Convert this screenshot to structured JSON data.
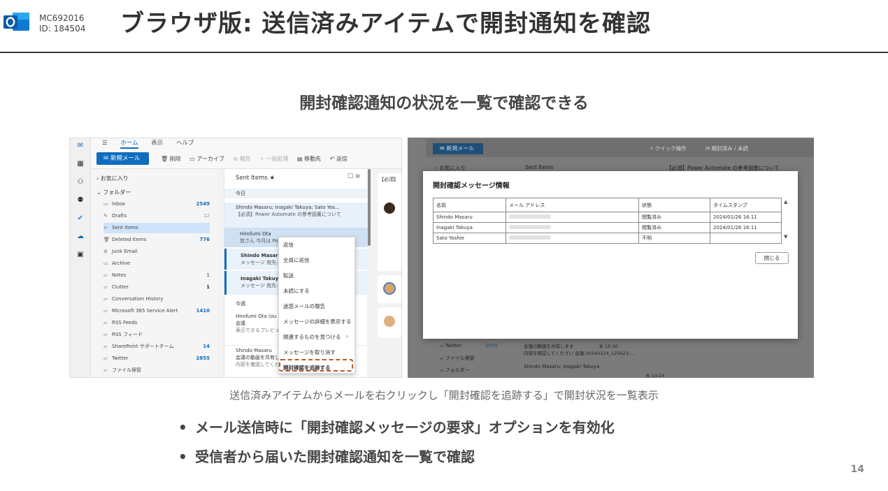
{
  "header": {
    "id_code": "MC692016",
    "id_label": "ID: 184504",
    "title": "ブラウザ版: 送信済みアイテムで開封通知を確認"
  },
  "subtitle": "開封確認通知の状況を一覧で確認できる",
  "left_screenshot": {
    "tabs": [
      "ホーム",
      "表示",
      "ヘルプ"
    ],
    "new_mail": "新規メール",
    "toolbar": [
      "削除",
      "アーカイブ",
      "報告",
      "一括処理",
      "移動先",
      "返信"
    ],
    "favorites": "お気に入り",
    "folders_head": "フォルダー",
    "folders": [
      {
        "name": "Inbox",
        "count": "2549"
      },
      {
        "name": "Drafts",
        "count": "12"
      },
      {
        "name": "Sent Items",
        "count": ""
      },
      {
        "name": "Deleted Items",
        "count": "776"
      },
      {
        "name": "Junk Email",
        "count": ""
      },
      {
        "name": "Archive",
        "count": ""
      },
      {
        "name": "Notes",
        "count": "1"
      },
      {
        "name": "Clutter",
        "count": "1"
      },
      {
        "name": "Conversation History",
        "count": ""
      },
      {
        "name": "Microsoft 365 Service Alert",
        "count": "1410"
      },
      {
        "name": "RSS Feeds",
        "count": ""
      },
      {
        "name": "RSS フィード",
        "count": ""
      },
      {
        "name": "SharePoint サポートチーム",
        "count": "14"
      },
      {
        "name": "Twitter",
        "count": "2855"
      },
      {
        "name": "ファイル保管",
        "count": ""
      }
    ],
    "list_title": "Sent Items",
    "group_today": "今日",
    "group_week": "今週",
    "messages": [
      {
        "from": "Shindo Masaru; Inagaki Takuya; Sato Yos...",
        "subject": "【必須】Power Automate の参考図書について"
      },
      {
        "from": "Hirofumi Ota",
        "subject": "皆さん 今月は Powe"
      },
      {
        "from": "Shindo Masaru",
        "subject": "メッセージ 宛先: Shi"
      },
      {
        "from": "Inagaki Takuya",
        "subject": "メッセージ 宛先: Ina"
      },
      {
        "from": "Hirofumi Ota (ou",
        "subject": "会議",
        "preview": "表示できるプレビューは"
      },
      {
        "from": "Shindo Masaru",
        "subject": "会議の動画を共有します",
        "preview": "内容を確認してくださ"
      }
    ],
    "context_menu": [
      "返信",
      "全員に返信",
      "転送",
      "未読にする",
      "迷惑メールの報告",
      "メッセージの詳細を表示する",
      "関連するものを見つける",
      "メッセージを取り消す",
      "開封確認を追跡する"
    ],
    "reading_tag": "【必須】"
  },
  "right_screenshot": {
    "new_mail": "新規メール",
    "toolbar": [
      "クイック操作",
      "開封済み / 未読"
    ],
    "list_title": "Sent Items",
    "folder1": "お気に入り",
    "reading_title": "【必須】Power Automate の参考図書について",
    "dialog_title": "開封確認メッセージ情報",
    "columns": [
      "名前",
      "メール アドレス",
      "状態",
      "タイムスタンプ"
    ],
    "rows": [
      {
        "name": "Shindo Masaru",
        "status": "閲覧済み",
        "time": "2024/01/26 16:11"
      },
      {
        "name": "Inagaki Takuya",
        "status": "閲覧済み",
        "time": "2024/01/26 16:11"
      },
      {
        "name": "Sato Yoshie",
        "status": "不明",
        "time": ""
      }
    ],
    "close": "閉じる",
    "bg_folders": [
      {
        "name": "Twitter",
        "count": "2855"
      },
      {
        "name": "ファイル保管",
        "count": ""
      },
      {
        "name": "フォルダー",
        "count": ""
      }
    ],
    "bg_msgs": [
      "会議の動画を共有します",
      "内容を確認してください 会議-20240124_125623-...",
      "Shindo Masaru; Inagaki Takuya"
    ],
    "bg_times": [
      "水 15:30",
      "水 13:24"
    ]
  },
  "caption": "送信済みアイテムからメールを右クリックし「開封確認を追跡する」で開封状況を一覧表示",
  "bullets": [
    "メール送信時に「開封確認メッセージの要求」オプションを有効化",
    "受信者から届いた開封確認通知を一覧で確認"
  ],
  "bullet_mark": "•",
  "page_number": "14",
  "colors": {
    "accent": "#0f6cbd",
    "highlight": "#c0562a"
  }
}
